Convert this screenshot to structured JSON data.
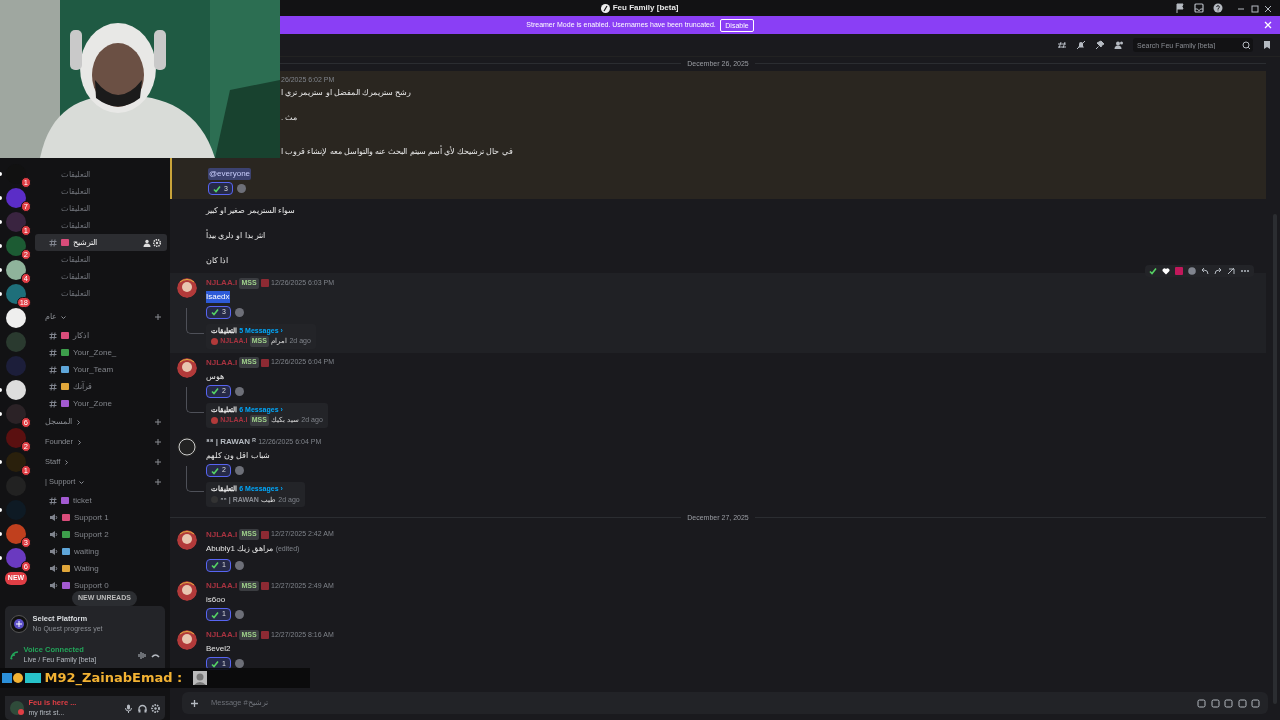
{
  "window": {
    "title": "Feu Family [beta]"
  },
  "banner": {
    "text": "Streamer Mode is enabled. Usernames have been truncated.",
    "button": "Disable"
  },
  "servers": [
    {
      "badge": "1",
      "unread": true
    },
    {
      "badge": "7",
      "unread": true
    },
    {
      "badge": "1",
      "unread": true
    },
    {
      "badge": "2",
      "unread": true
    },
    {
      "badge": "4",
      "unread": true
    },
    {
      "badge": "18",
      "unread": true
    },
    {
      "unread": false
    },
    {
      "unread": false
    },
    {
      "unread": false
    },
    {
      "unread": true
    },
    {
      "badge": "6",
      "unread": true
    },
    {
      "badge": "2",
      "unread": false
    },
    {
      "badge": "1",
      "unread": true
    },
    {
      "unread": false
    },
    {
      "unread": true
    },
    {
      "badge": "3",
      "unread": true
    },
    {
      "badge": "6",
      "unread": true
    }
  ],
  "new_pill": "NEW",
  "channels": [
    {
      "kind": "thread",
      "name": "التعليقات"
    },
    {
      "kind": "thread",
      "name": "التعليقات"
    },
    {
      "kind": "thread",
      "name": "التعليقات"
    },
    {
      "kind": "thread",
      "name": "التعليقات"
    },
    {
      "kind": "text",
      "name": "الترشيح",
      "selected": true
    },
    {
      "kind": "thread",
      "name": "التعليقات"
    },
    {
      "kind": "thread",
      "name": "التعليقات"
    },
    {
      "kind": "thread",
      "name": "التعليقات"
    },
    {
      "kind": "category",
      "name": "عام",
      "expanded": true
    },
    {
      "kind": "text",
      "name": "اذكار",
      "selected": false
    },
    {
      "kind": "text",
      "name": "Your_Zone_",
      "selected": false
    },
    {
      "kind": "text",
      "name": "Your_Team",
      "selected": false
    },
    {
      "kind": "text",
      "name": "قرآنك",
      "selected": false
    },
    {
      "kind": "text",
      "name": "Your_Zone",
      "selected": false
    },
    {
      "kind": "category",
      "name": "المسجل",
      "expanded": false
    },
    {
      "kind": "category",
      "name": "Founder",
      "expanded": false
    },
    {
      "kind": "category",
      "name": "Staff",
      "expanded": false
    },
    {
      "kind": "category",
      "name": "| Support",
      "expanded": true
    },
    {
      "kind": "text",
      "name": "ticket",
      "selected": false
    },
    {
      "kind": "voice",
      "name": "Support 1"
    },
    {
      "kind": "voice",
      "name": "Support 2"
    },
    {
      "kind": "voice",
      "name": "waiting"
    },
    {
      "kind": "voice",
      "name": "Wating"
    },
    {
      "kind": "voice",
      "name": "Support 0"
    }
  ],
  "new_unreads": "NEW UNREADS",
  "quest": {
    "title": "Select Platform",
    "subtitle": "No Quest progress yet"
  },
  "voice": {
    "status": "Voice Connected",
    "channel": "Live / Feu Family [beta]"
  },
  "overlay_chat": {
    "name": "M92_ZainabEmad :"
  },
  "user": {
    "name": "Feu is here ...",
    "status": "my first st..."
  },
  "search": {
    "placeholder": "Search Feu Family [beta]"
  },
  "messages": [
    {
      "kind": "date",
      "text": "December 26, 2025"
    },
    {
      "kind": "message",
      "highlighted": true,
      "time": "26/2025 6:02 PM",
      "lines": [
        "رشح ستريمرك المفضل او ستريمر تري ا",
        "مث .",
        "في حال ترشيحك لأي أسم سيتم البحث عنه والتواسل معه لإنشاء قروب ا"
      ],
      "mention": "@everyone",
      "reaction": {
        "count": "3",
        "selected": true
      }
    },
    {
      "kind": "continuation",
      "lines": [
        "سواء الستريمر صغير او كبير",
        "انثر بدا او دلري بيدأ",
        "اذا كان"
      ]
    },
    {
      "kind": "message",
      "author": "NJLAA.I",
      "badge": "MSS",
      "time": "12/26/2025 6:03 PM",
      "lines": [
        "Isaedx"
      ],
      "text_selected": true,
      "hovered": true,
      "reaction": {
        "count": "3",
        "selected": true
      },
      "thread": {
        "label": "التعليقات",
        "count": "5 Messages ›",
        "author": "NJLAA.I",
        "badge": "MSS",
        "preview": "امرام",
        "ago": "2d ago"
      }
    },
    {
      "kind": "message",
      "author": "NJLAA.I",
      "badge": "MSS",
      "time": "12/26/2025 6:04 PM",
      "lines": [
        "هوس"
      ],
      "reaction": {
        "count": "2",
        "selected": true
      },
      "thread": {
        "label": "التعليقات",
        "count": "6 Messages ›",
        "author": "NJLAA.I",
        "badge": "MSS",
        "preview": "سيد بكيك",
        "ago": "2d ago"
      }
    },
    {
      "kind": "message",
      "author": "⁸⁸ | RAWAN ᴿ",
      "time": "12/26/2025 6:04 PM",
      "lines": [
        "شباب اقل ون كلهم"
      ],
      "reaction": {
        "count": "2",
        "selected": true
      },
      "thread": {
        "label": "التعليقات",
        "count": "6 Messages ›",
        "author": "⁸⁸ | RAWAN",
        "preview": "طيب",
        "ago": "2d ago"
      }
    },
    {
      "kind": "date",
      "text": "December 27, 2025"
    },
    {
      "kind": "message",
      "author": "NJLAA.I",
      "badge": "MSS",
      "time": "12/27/2025 2:42 AM",
      "lines": [
        "Abubly1 مراهق زيك"
      ],
      "edited": "(edited)",
      "reaction": {
        "count": "1",
        "selected": true
      }
    },
    {
      "kind": "message",
      "author": "NJLAA.I",
      "badge": "MSS",
      "time": "12/27/2025 2:49 AM",
      "lines": [
        "is6oo"
      ],
      "reaction": {
        "count": "1",
        "selected": true
      }
    },
    {
      "kind": "message",
      "author": "NJLAA.I",
      "badge": "MSS",
      "time": "12/27/2025 8:16 AM",
      "lines": [
        "Bevel2"
      ],
      "reaction": {
        "count": "1",
        "selected": true
      }
    }
  ],
  "composer": {
    "placeholder": "Message #ترشيح"
  }
}
